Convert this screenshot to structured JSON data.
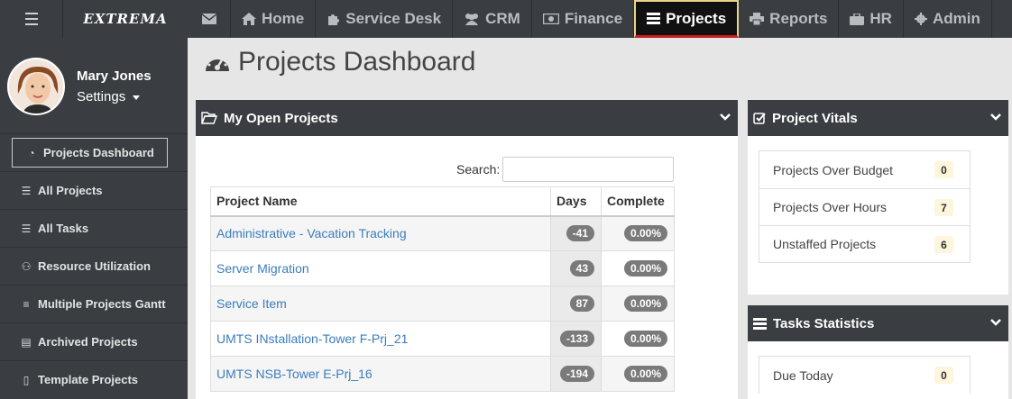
{
  "app": {
    "logo": "EXTREMA"
  },
  "topnav": {
    "items": [
      {
        "label": "Home",
        "icon": "home-icon"
      },
      {
        "label": "Service Desk",
        "icon": "puzzle-icon"
      },
      {
        "label": "CRM",
        "icon": "users-icon"
      },
      {
        "label": "Finance",
        "icon": "money-icon"
      },
      {
        "label": "Projects",
        "icon": "list-icon",
        "active": true
      },
      {
        "label": "Reports",
        "icon": "print-icon"
      },
      {
        "label": "HR",
        "icon": "briefcase-icon"
      },
      {
        "label": "Admin",
        "icon": "gear-icon"
      }
    ]
  },
  "user": {
    "name": "Mary Jones",
    "settings_label": "Settings"
  },
  "sidebar": {
    "items": [
      {
        "label": "Projects Dashboard",
        "icon": "dashboard-icon",
        "active": true
      },
      {
        "label": "All Projects",
        "icon": "list-icon"
      },
      {
        "label": "All Tasks",
        "icon": "list-icon"
      },
      {
        "label": "Resource Utilization",
        "icon": "users-icon"
      },
      {
        "label": "Multiple Projects Gantt",
        "icon": "sliders-icon"
      },
      {
        "label": "Archived Projects",
        "icon": "archive-icon"
      },
      {
        "label": "Template Projects",
        "icon": "file-icon"
      }
    ]
  },
  "main": {
    "title": "Projects Dashboard",
    "open_projects": {
      "title": "My Open Projects",
      "search_label": "Search:",
      "search_value": "",
      "columns": [
        "Project Name",
        "Days",
        "Complete"
      ],
      "rows": [
        {
          "name": "Administrative - Vacation Tracking",
          "days": "-41",
          "complete": "0.00%"
        },
        {
          "name": "Server Migration",
          "days": "43",
          "complete": "0.00%"
        },
        {
          "name": "Service Item",
          "days": "87",
          "complete": "0.00%"
        },
        {
          "name": "UMTS INstallation-Tower F-Prj_21",
          "days": "-133",
          "complete": "0.00%"
        },
        {
          "name": "UMTS NSB-Tower E-Prj_16",
          "days": "-194",
          "complete": "0.00%"
        }
      ]
    },
    "vitals": {
      "title": "Project Vitals",
      "items": [
        {
          "label": "Projects Over Budget",
          "count": "0"
        },
        {
          "label": "Projects Over Hours",
          "count": "7"
        },
        {
          "label": "Unstaffed Projects",
          "count": "6"
        }
      ]
    },
    "tasks": {
      "title": "Tasks Statistics",
      "items": [
        {
          "label": "Due Today",
          "count": "0"
        }
      ]
    }
  }
}
